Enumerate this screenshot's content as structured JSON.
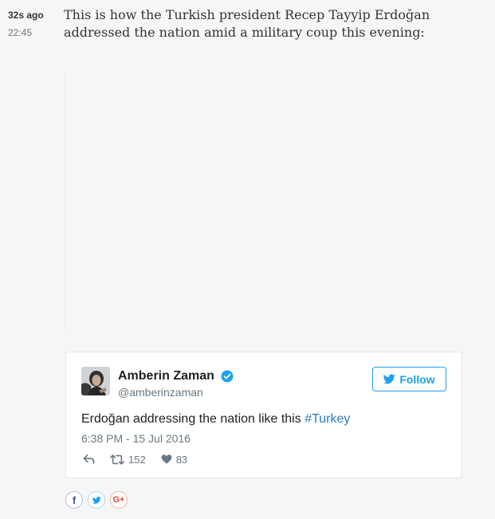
{
  "entry": {
    "time_ago": "32s ago",
    "time": "22:45",
    "headline": "This is how the Turkish president Recep Tayyip Erdoğan addressed the nation amid a military coup this evening:"
  },
  "tweet": {
    "author_name": "Amberin Zaman",
    "author_handle": "@amberinzaman",
    "verified": true,
    "follow_label": "Follow",
    "text_before_hashtag": "Erdoğan addressing the nation like this ",
    "hashtag": "#Turkey",
    "date": "6:38 PM - 15 Jul 2016",
    "retweet_count": "152",
    "like_count": "83",
    "icons": [
      "reply-icon",
      "retweet-icon",
      "heart-icon",
      "twitter-bird-icon",
      "verified-badge-icon"
    ]
  },
  "share": {
    "facebook_glyph": "f",
    "google_plus_glyph": "G+",
    "icons": [
      "facebook-icon",
      "twitter-icon",
      "google-plus-icon"
    ]
  },
  "colors": {
    "twitter_blue": "#1da1f2",
    "hashtag_blue": "#2b7bb9",
    "facebook_blue": "#3b5998",
    "google_red": "#dd4b39",
    "meta_gray": "#697882"
  }
}
